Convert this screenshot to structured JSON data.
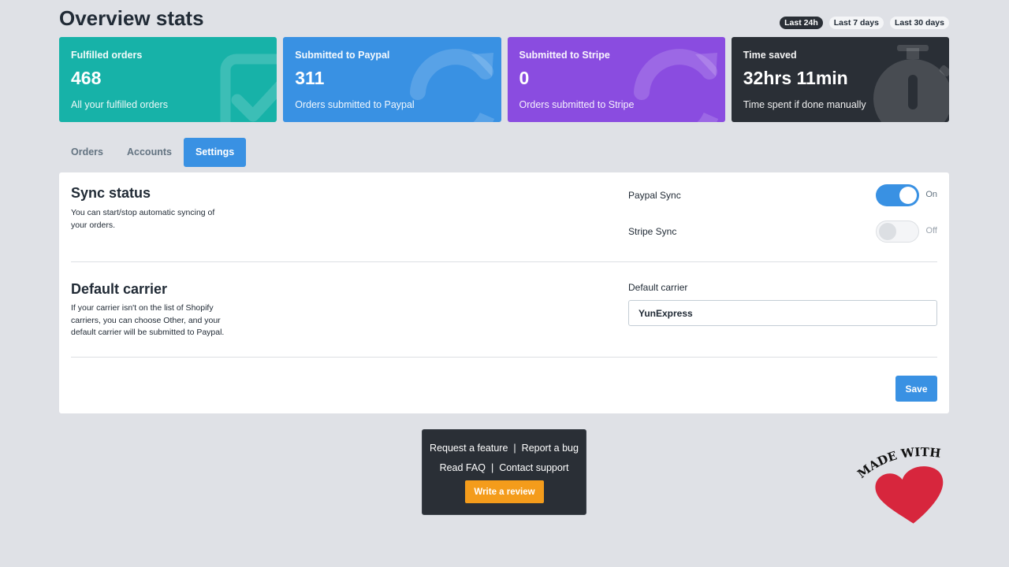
{
  "header": {
    "title": "Overview stats",
    "ranges": [
      {
        "label": "Last 24h",
        "active": true
      },
      {
        "label": "Last 7 days",
        "active": false
      },
      {
        "label": "Last 30 days",
        "active": false
      }
    ]
  },
  "stats": [
    {
      "title": "Fulfilled orders",
      "value": "468",
      "desc": "All your fulfilled orders",
      "color": "#17b2a8",
      "icon": "checkbox-icon"
    },
    {
      "title": "Submitted to Paypal",
      "value": "311",
      "desc": "Orders submitted to Paypal",
      "color": "#3991e3",
      "icon": "sync-icon"
    },
    {
      "title": "Submitted to Stripe",
      "value": "0",
      "desc": "Orders submitted to Stripe",
      "color": "#8a4ce0",
      "icon": "sync-icon"
    },
    {
      "title": "Time saved",
      "value": "32hrs 11min",
      "desc": "Time spent if done manually",
      "color": "#2a2f36",
      "icon": "stopwatch-icon"
    }
  ],
  "tabs": [
    {
      "label": "Orders",
      "active": false
    },
    {
      "label": "Accounts",
      "active": false
    },
    {
      "label": "Settings",
      "active": true
    }
  ],
  "settings": {
    "sync": {
      "title": "Sync status",
      "desc": "You can start/stop automatic syncing of your orders.",
      "paypal_label": "Paypal Sync",
      "paypal_state": "On",
      "stripe_label": "Stripe Sync",
      "stripe_state": "Off"
    },
    "carrier": {
      "title": "Default carrier",
      "desc": "If your carrier isn't on the list of Shopify carriers, you can choose Other, and your default carrier will be submitted to Paypal.",
      "field_label": "Default carrier",
      "value": "YunExpress"
    },
    "save_label": "Save"
  },
  "footer": {
    "request_feature": "Request a feature",
    "report_bug": "Report a bug",
    "read_faq": "Read FAQ",
    "contact_support": "Contact support",
    "separator": "|",
    "review_label": "Write a review"
  },
  "badge": {
    "text": "MADE WITH",
    "heart_color": "#d7263d"
  }
}
